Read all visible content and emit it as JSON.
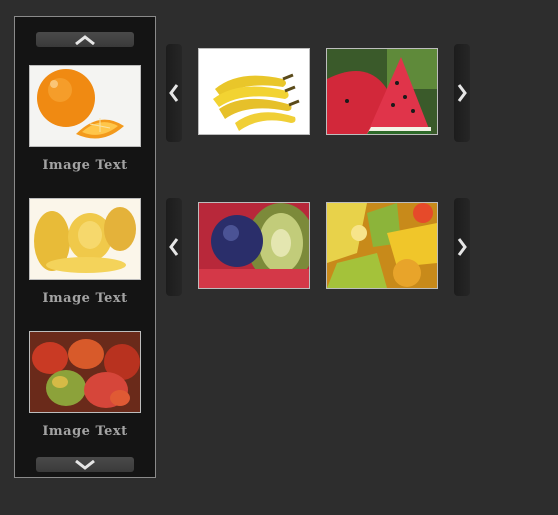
{
  "vertical_carousel": {
    "up_icon": "chevron-up-icon",
    "down_icon": "chevron-down-icon",
    "items": [
      {
        "image": "orange",
        "caption": "Image Text"
      },
      {
        "image": "mango-slices",
        "caption": "Image Text"
      },
      {
        "image": "mangoes",
        "caption": "Image Text"
      }
    ]
  },
  "horizontal_carousels": [
    {
      "prev_icon": "chevron-left-icon",
      "next_icon": "chevron-right-icon",
      "images": [
        "bananas",
        "watermelon"
      ]
    },
    {
      "prev_icon": "chevron-left-icon",
      "next_icon": "chevron-right-icon",
      "images": [
        "blueberry-kiwi-strawberry",
        "fruit-salad"
      ]
    }
  ],
  "colors": {
    "background": "#2d2d2d",
    "panel": "#141414",
    "panel_border": "#8a8a8a",
    "caption": "#a3a3a3",
    "arrow": "#e6e6e6"
  }
}
